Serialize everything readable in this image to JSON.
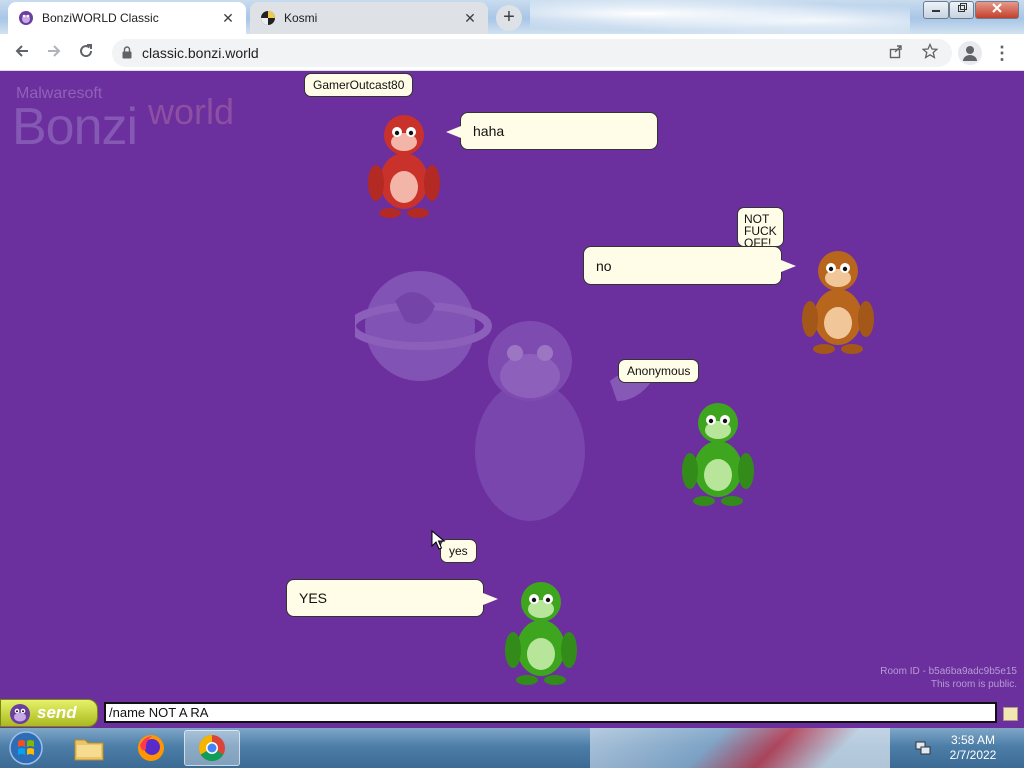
{
  "browser": {
    "tabs": [
      {
        "title": "BonziWORLD Classic",
        "active": true
      },
      {
        "title": "Kosmi",
        "active": false
      }
    ],
    "new_tab_glyph": "+",
    "close_glyph": "✕",
    "url": "classic.bonzi.world"
  },
  "page": {
    "logo_small": "Malwaresoft",
    "logo_big": "Bonzi",
    "logo_world": "world",
    "background_color": "#6b2f9e",
    "room_id": "Room ID - b5a6ba9adc9b5e15",
    "room_status": "This room is public."
  },
  "users": [
    {
      "name": "GamerOutcast80",
      "bubble": "haha",
      "color": "red"
    },
    {
      "name": "NOT FUCK OFF!",
      "bubble": "no",
      "color": "brown"
    },
    {
      "name": "Anonymous",
      "bubble": "",
      "color": "green"
    },
    {
      "name": "yes",
      "bubble": "YES",
      "color": "green"
    }
  ],
  "chat": {
    "send_label": "send",
    "input_value": "/name NOT A RA"
  },
  "taskbar": {
    "time": "3:58 AM",
    "date": "2/7/2022",
    "apps": [
      "explorer-icon",
      "firefox-icon",
      "chrome-icon"
    ]
  }
}
